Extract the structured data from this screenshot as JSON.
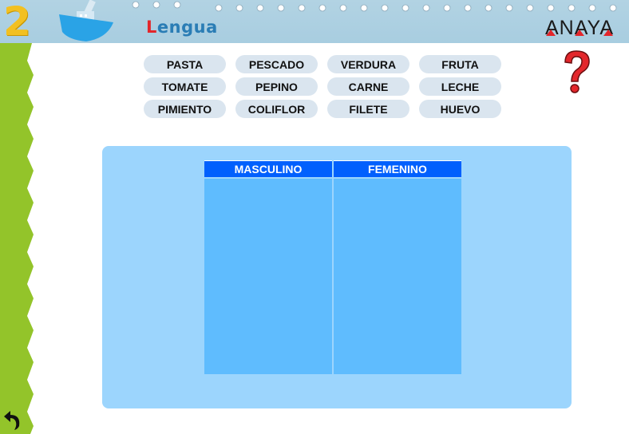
{
  "header": {
    "unit_number": "2",
    "subject_first_letter": "L",
    "subject_rest": "engua",
    "publisher_logo": "ANAYA"
  },
  "icons": {
    "boat": "boat-icon",
    "help": "question-mark-icon",
    "back": "back-arrow-icon"
  },
  "words": [
    "PASTA",
    "PESCADO",
    "VERDURA",
    "FRUTA",
    "TOMATE",
    "PEPINO",
    "CARNE",
    "LECHE",
    "PIMIENTO",
    "COLIFLOR",
    "FILETE",
    "HUEVO"
  ],
  "table": {
    "columns": [
      "MASCULINO",
      "FEMENINO"
    ]
  },
  "colors": {
    "header_bg": "#a8cde0",
    "side_green": "#93c42a",
    "chip_bg": "#dae5ef",
    "board_bg": "#9cd5fd",
    "column_header": "#0160fd",
    "column_body": "#5fbcfe",
    "help_red": "#e3262b"
  }
}
